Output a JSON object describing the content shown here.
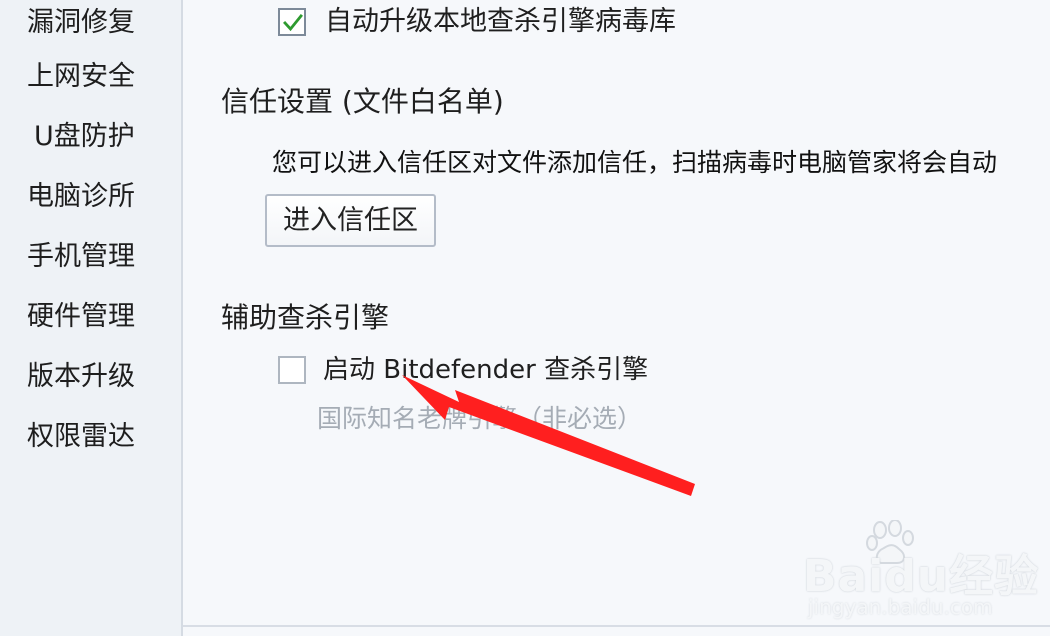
{
  "sidebar": {
    "items": [
      {
        "label": "漏洞修复"
      },
      {
        "label": "上网安全"
      },
      {
        "label": "U盘防护"
      },
      {
        "label": "电脑诊所"
      },
      {
        "label": "手机管理"
      },
      {
        "label": "硬件管理"
      },
      {
        "label": "版本升级"
      },
      {
        "label": "权限雷达"
      }
    ]
  },
  "main": {
    "auto_upgrade_label": "自动升级本地查杀引擎病毒库",
    "trust_title": "信任设置 (文件白名单)",
    "trust_desc": "您可以进入信任区对文件添加信任，扫描病毒时电脑管家将会自动",
    "trust_button": "进入信任区",
    "engine_title": "辅助查杀引擎",
    "bitdefender_label": "启动 Bitdefender 查杀引擎",
    "bitdefender_sub": "国际知名老牌引擎（非必选）"
  },
  "watermark": {
    "brand": "Baidu经验",
    "url": "jingyan.baidu.com"
  },
  "colors": {
    "accent_check": "#2d9a2f",
    "arrow": "#ff1f1f"
  }
}
